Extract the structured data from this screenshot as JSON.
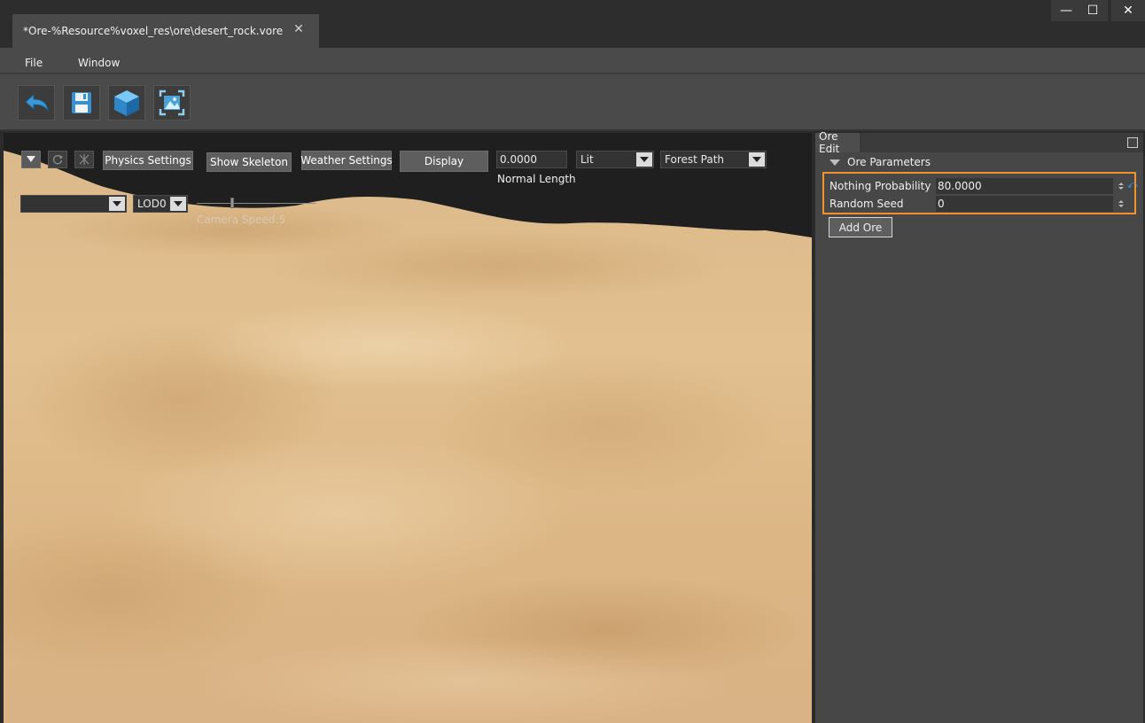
{
  "window": {
    "tab_title": "*Ore-%Resource%voxel_res\\ore\\desert_rock.vore",
    "tab_close_glyph": "✕",
    "minimize_glyph": "—",
    "maximize_glyph": "☐",
    "close_glyph": "✕"
  },
  "menu": {
    "items": [
      "File",
      "Window"
    ]
  },
  "toolbar": {
    "buttons": [
      {
        "name": "undo-icon"
      },
      {
        "name": "save-icon"
      },
      {
        "name": "cube-icon"
      },
      {
        "name": "screenshot-icon"
      }
    ]
  },
  "viewport": {
    "physics_settings_label": "Physics Settings",
    "show_skeleton_label": "Show Skeleton",
    "weather_settings_label": "Weather Settings",
    "display_label": "Display",
    "normal_length_value": "0.0000",
    "normal_length_label": "Normal Length",
    "lit_value": "Lit",
    "forest_path_value": "Forest Path",
    "first_combo_value": "",
    "lod_value": "LOD0",
    "camera_speed_label": "Camera Speed:5",
    "camera_speed_slider_fraction": 0.28,
    "colors": {
      "sky": "#1f1f1f",
      "sand_light": "#e6c79a",
      "sand_mid": "#d4a874",
      "sand_dark": "#b8875a"
    }
  },
  "panel": {
    "tab_label": "Ore Edit",
    "section_title": "Ore Parameters",
    "highlight_color": "#f0922e",
    "params": [
      {
        "label": "Nothing Probability",
        "value": "80.0000"
      },
      {
        "label": "Random Seed",
        "value": "0"
      }
    ],
    "add_button_label": "Add Ore"
  }
}
